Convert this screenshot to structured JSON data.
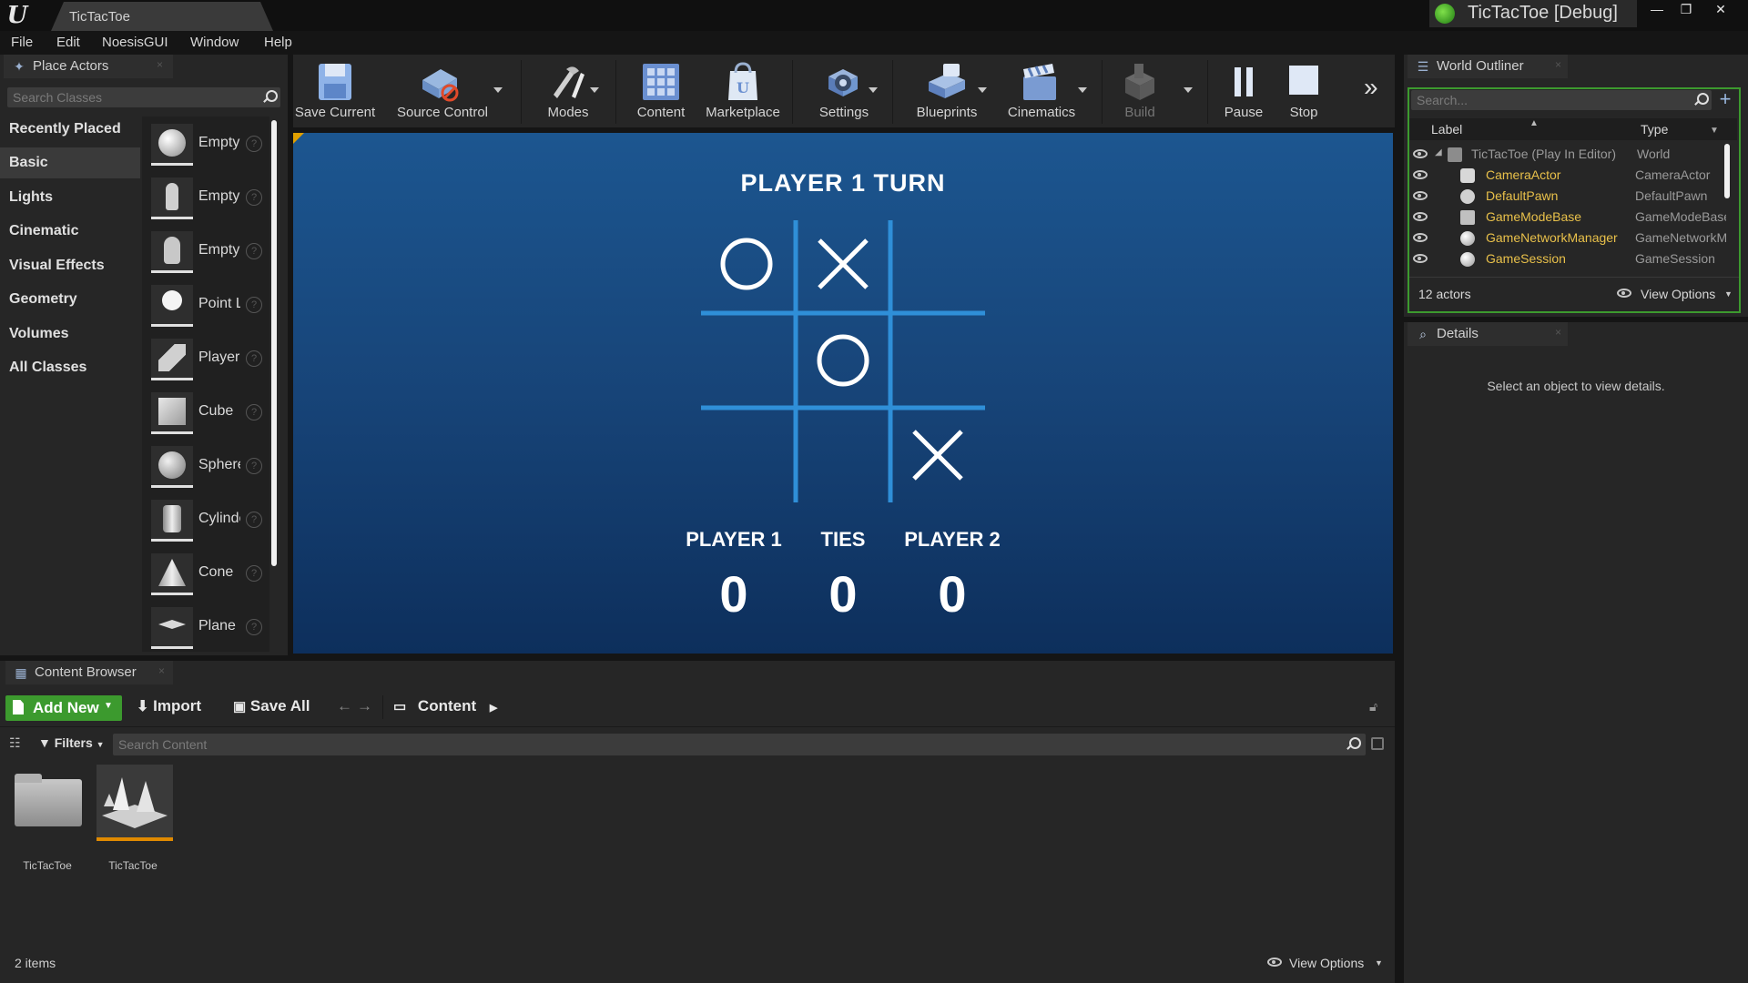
{
  "window": {
    "doc_tab": "TicTacToe",
    "app_title": "TicTacToe [Debug]",
    "minimize": "—",
    "maximize": "❐",
    "close": "✕"
  },
  "menu": [
    "File",
    "Edit",
    "NoesisGUI",
    "Window",
    "Help"
  ],
  "place_actors": {
    "tab_label": "Place Actors",
    "search_placeholder": "Search Classes",
    "categories": [
      "Recently Placed",
      "Basic",
      "Lights",
      "Cinematic",
      "Visual Effects",
      "Geometry",
      "Volumes",
      "All Classes"
    ],
    "active_category": "Basic",
    "items": [
      "Empty Actor",
      "Empty Character",
      "Empty Pawn",
      "Point Light",
      "Player Start",
      "Cube",
      "Sphere",
      "Cylinder",
      "Cone",
      "Plane"
    ],
    "help_glyph": "?"
  },
  "toolbar": {
    "buttons": [
      "Save Current",
      "Source Control",
      "Modes",
      "Content",
      "Marketplace",
      "Settings",
      "Blueprints",
      "Cinematics",
      "Build",
      "Pause",
      "Stop"
    ],
    "more": "»"
  },
  "game": {
    "turn_text": "PLAYER 1 TURN",
    "board": [
      "O",
      "X",
      "",
      "",
      "O",
      "",
      "",
      "",
      "X"
    ],
    "scores": [
      {
        "label": "PLAYER 1",
        "value": "0"
      },
      {
        "label": "TIES",
        "value": "0"
      },
      {
        "label": "PLAYER 2",
        "value": "0"
      }
    ],
    "line_color": "#2f8fd8",
    "mark_color": "#ffffff"
  },
  "world_outliner": {
    "tab_label": "World Outliner",
    "search_placeholder": "Search...",
    "col_label": "Label",
    "col_type": "Type",
    "rows": [
      {
        "label": "TicTacToe (Play In Editor)",
        "type": "World"
      },
      {
        "label": "CameraActor",
        "type": "CameraActor"
      },
      {
        "label": "DefaultPawn",
        "type": "DefaultPawn"
      },
      {
        "label": "GameModeBase",
        "type": "GameModeBase"
      },
      {
        "label": "GameNetworkManager",
        "type": "GameNetworkManager"
      },
      {
        "label": "GameSession",
        "type": "GameSession"
      }
    ],
    "actor_count": "12 actors",
    "view_options": "View Options"
  },
  "details": {
    "tab_label": "Details",
    "empty_text": "Select an object to view details."
  },
  "content_browser": {
    "tab_label": "Content Browser",
    "add_new": "Add New",
    "import": "Import",
    "save_all": "Save All",
    "path": "Content",
    "filters": "Filters",
    "search_placeholder": "Search Content",
    "assets": [
      {
        "name": "TicTacToe",
        "kind": "folder"
      },
      {
        "name": "TicTacToe",
        "kind": "map"
      }
    ],
    "item_count": "2 items",
    "view_options": "View Options"
  }
}
